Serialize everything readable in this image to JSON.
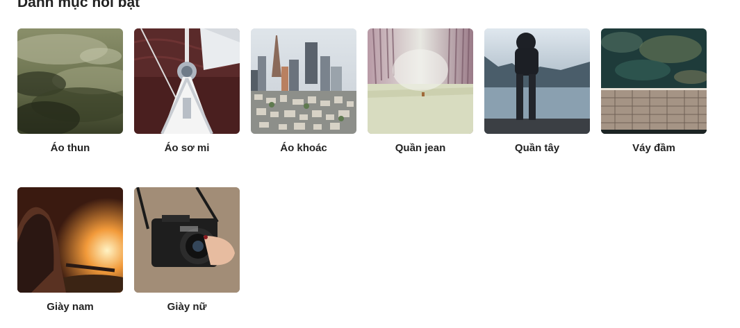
{
  "section": {
    "title": "Danh mục nổi bật"
  },
  "categories": [
    {
      "label": "Áo thun",
      "image": "foggy-forest-image"
    },
    {
      "label": "Áo sơ mi",
      "image": "sailboat-image"
    },
    {
      "label": "Áo khoác",
      "image": "city-skyline-image"
    },
    {
      "label": "Quần jean",
      "image": "misty-road-image"
    },
    {
      "label": "Quần tây",
      "image": "man-on-pier-image"
    },
    {
      "label": "Váy đầm",
      "image": "aerial-dock-image"
    },
    {
      "label": "Giày nam",
      "image": "girl-with-fire-image"
    },
    {
      "label": "Giày nữ",
      "image": "camera-hands-image"
    }
  ]
}
